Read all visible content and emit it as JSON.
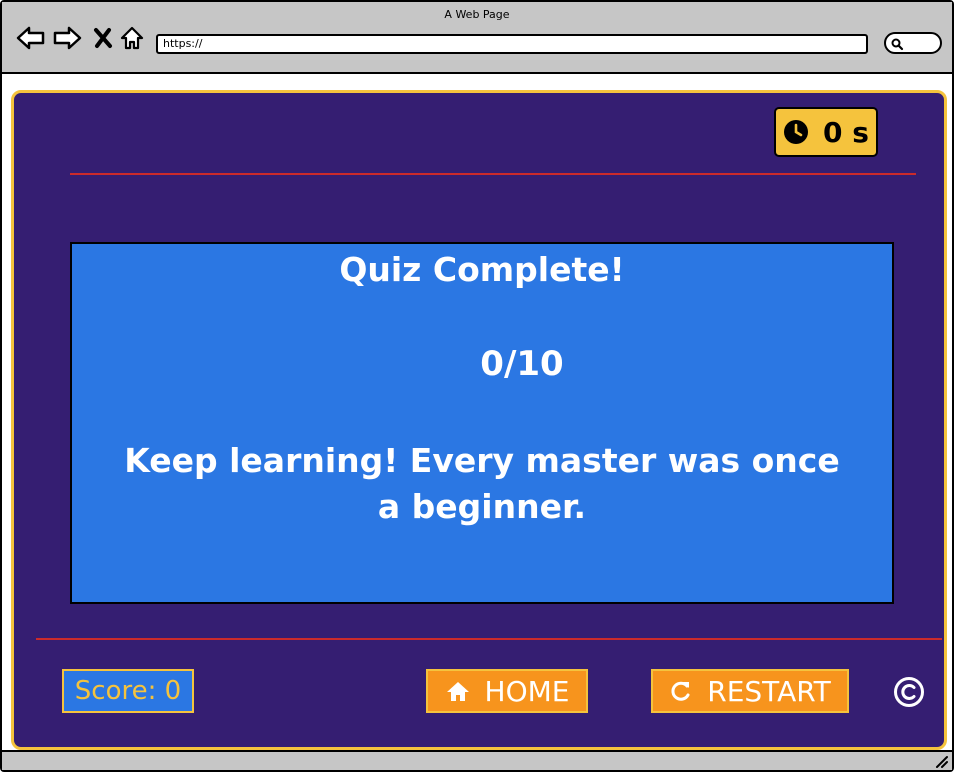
{
  "window": {
    "title": "A Web Page",
    "url": "https://"
  },
  "nav_icons": [
    "back-arrow-icon",
    "forward-arrow-icon",
    "close-icon",
    "home-icon",
    "search-icon"
  ],
  "timer": {
    "icon": "clock-icon",
    "value": "0 s"
  },
  "result": {
    "title": "Quiz Complete!",
    "score": "0/10",
    "message": "Keep learning! Every master was once a beginner."
  },
  "footer": {
    "score_label": "Score: 0",
    "home_label": "HOME",
    "restart_label": "RESTART",
    "copyright_icon": "copyright-icon"
  },
  "colors": {
    "app_background": "#351e72",
    "app_border": "#f5c33d",
    "card_background": "#2b77e3",
    "button_background": "#f7941d",
    "divider": "#cc2b2b",
    "timer_background": "#f5c33d"
  }
}
